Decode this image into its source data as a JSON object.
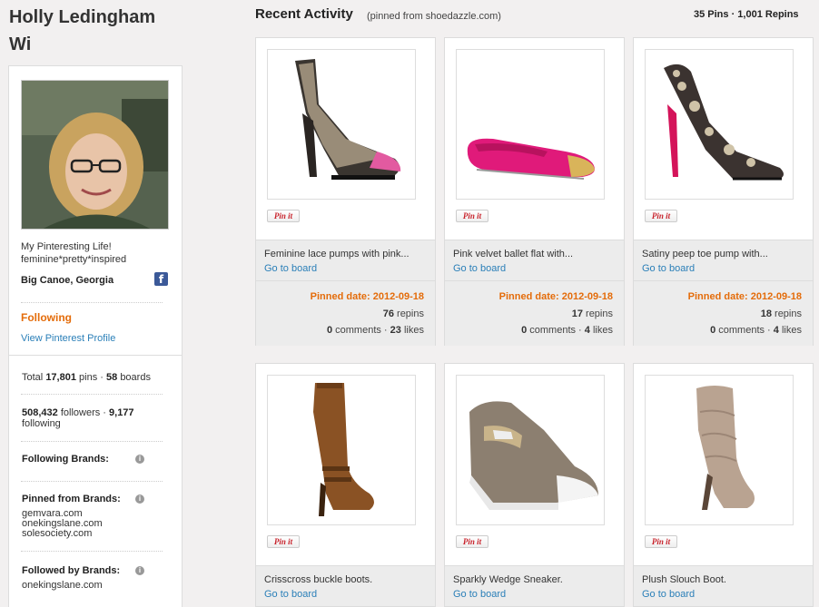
{
  "profile": {
    "name": "Holly Ledingham Wi",
    "bio_line1": "My Pinteresting Life!",
    "bio_line2": "feminine*pretty*inspired",
    "location": "Big Canoe, Georgia",
    "following_label": "Following",
    "view_profile_label": "View Pinterest Profile",
    "facebook_icon": "facebook-icon"
  },
  "stats": {
    "total_prefix": "Total",
    "pins_count": "17,801",
    "pins_label": "pins ·",
    "boards_count": "58",
    "boards_label": "boards",
    "followers_count": "508,432",
    "followers_label": "followers ·",
    "following_count": "9,177",
    "following_label": "following"
  },
  "brands": {
    "following_brands": "Following Brands:",
    "pinned_from_brands": "Pinned from Brands:",
    "pinned_from_list": [
      "gemvara.com",
      "onekingslane.com",
      "solesociety.com"
    ],
    "followed_by_brands": "Followed by Brands:",
    "followed_by_list": [
      "onekingslane.com"
    ]
  },
  "activity": {
    "title": "Recent Activity",
    "subtitle": "(pinned from shoedazzle.com)",
    "summary": "35 Pins · 1,001 Repins"
  },
  "pins": [
    {
      "desc": "Feminine lace pumps with pink...",
      "goto": "Go to board",
      "pin_label": "Pin it",
      "pinned": "Pinned date: 2012-09-18",
      "repins_num": "76",
      "repins_label": "repins",
      "comments_num": "0",
      "comments_label": "comments ·",
      "likes_num": "23",
      "likes_label": "likes"
    },
    {
      "desc": "Pink velvet ballet flat with...",
      "goto": "Go to board",
      "pin_label": "Pin it",
      "pinned": "Pinned date: 2012-09-18",
      "repins_num": "17",
      "repins_label": "repins",
      "comments_num": "0",
      "comments_label": "comments ·",
      "likes_num": "4",
      "likes_label": "likes"
    },
    {
      "desc": "Satiny peep toe pump with...",
      "goto": "Go to board",
      "pin_label": "Pin it",
      "pinned": "Pinned date: 2012-09-18",
      "repins_num": "18",
      "repins_label": "repins",
      "comments_num": "0",
      "comments_label": "comments ·",
      "likes_num": "4",
      "likes_label": "likes"
    },
    {
      "desc": "Crisscross buckle boots.",
      "goto": "Go to board",
      "pin_label": "Pin it"
    },
    {
      "desc": "Sparkly Wedge Sneaker.",
      "goto": "Go to board",
      "pin_label": "Pin it"
    },
    {
      "desc": "Plush Slouch Boot.",
      "goto": "Go to board",
      "pin_label": "Pin it"
    }
  ],
  "colors": {
    "accent_orange": "#e46c0a",
    "link_blue": "#2a7fb8",
    "pinterest_red": "#c8232c"
  }
}
